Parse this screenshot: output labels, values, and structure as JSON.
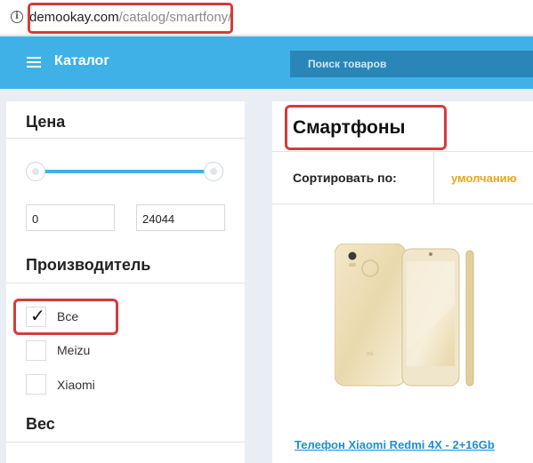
{
  "address_bar": {
    "domain": "demookay.com",
    "path": "/catalog/smartfony/"
  },
  "header": {
    "catalog_label": "Каталог",
    "search_placeholder": "Поиск товаров"
  },
  "sidebar": {
    "price": {
      "title": "Цена",
      "min_value": "0",
      "max_value": "24044"
    },
    "manufacturer": {
      "title": "Производитель",
      "options": [
        {
          "label": "Все",
          "checked": true
        },
        {
          "label": "Meizu",
          "checked": false
        },
        {
          "label": "Xiaomi",
          "checked": false
        }
      ]
    },
    "weight": {
      "title": "Вес"
    }
  },
  "main": {
    "page_title": "Смартфоны",
    "sort_label": "Сортировать по:",
    "sort_value": "умолчанию",
    "product": {
      "title": "Телефон Xiaomi Redmi 4X - 2+16Gb",
      "icon": "smartphone-image"
    }
  },
  "colors": {
    "accent": "#3fb1e6",
    "search_bg": "#2b86b8",
    "sort_value": "#f0a31c",
    "link": "#1d8fd3",
    "highlight": "#d43c3c"
  }
}
